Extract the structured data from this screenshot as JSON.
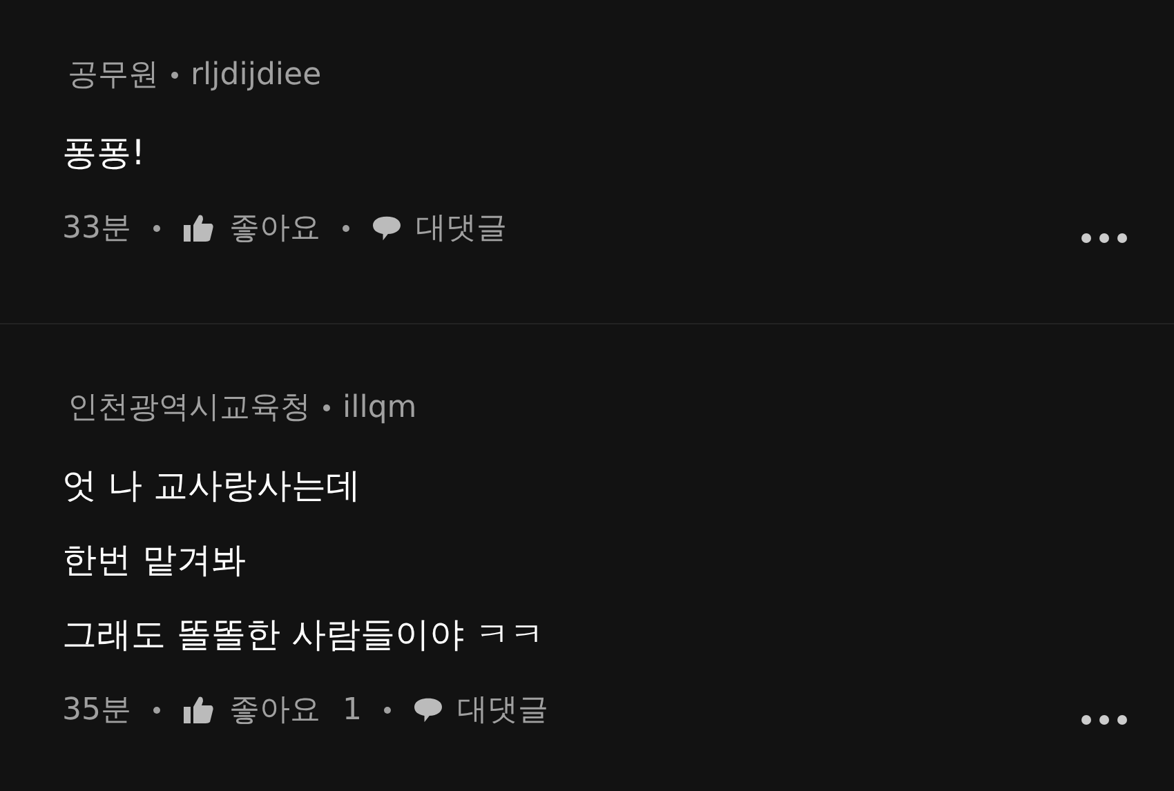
{
  "comments": [
    {
      "author": "공무원",
      "user": "rljdijdiee",
      "lines": [
        "퐁퐁!"
      ],
      "time": "33분",
      "like_label": "좋아요",
      "reply_label": "대댓글"
    },
    {
      "author": "인천광역시교육청",
      "user": "illqm",
      "lines": [
        "엇 나 교사랑사는데",
        "한번 맡겨봐",
        "그래도 똘똘한 사람들이야 ㅋㅋ"
      ],
      "time": "35분",
      "like_label": "좋아요",
      "like_count": "1",
      "reply_label": "대댓글"
    }
  ]
}
